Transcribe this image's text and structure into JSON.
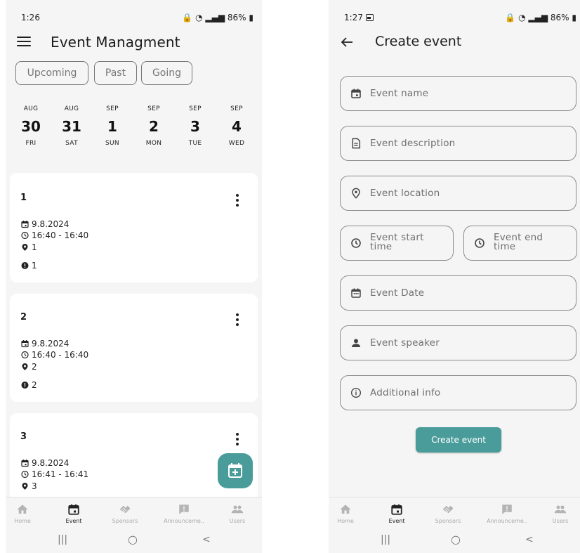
{
  "colors": {
    "accent": "#4a9c9b",
    "background": "#f5f5f5",
    "card": "#ffffff"
  },
  "left": {
    "status": {
      "time": "1:26",
      "battery": "86%"
    },
    "title": "Event Managment",
    "filters": [
      "Upcoming",
      "Past",
      "Going"
    ],
    "dates": [
      {
        "month": "AUG",
        "day": "30",
        "dow": "FRI"
      },
      {
        "month": "AUG",
        "day": "31",
        "dow": "SAT"
      },
      {
        "month": "SEP",
        "day": "1",
        "dow": "SUN"
      },
      {
        "month": "SEP",
        "day": "2",
        "dow": "MON"
      },
      {
        "month": "SEP",
        "day": "3",
        "dow": "TUE"
      },
      {
        "month": "SEP",
        "day": "4",
        "dow": "WED"
      }
    ],
    "events": [
      {
        "title": "1",
        "date": "9.8.2024",
        "time": "16:40 - 16:40",
        "location": "1",
        "info": "1"
      },
      {
        "title": "2",
        "date": "9.8.2024",
        "time": "16:40 - 16:40",
        "location": "2",
        "info": "2"
      },
      {
        "title": "3",
        "date": "9.8.2024",
        "time": "16:41 - 16:41",
        "location": "3"
      }
    ],
    "fab_icon": "calendar-add-icon"
  },
  "right": {
    "status": {
      "time": "1:27",
      "battery": "86%"
    },
    "title": "Create event",
    "fields": {
      "name": "Event name",
      "description": "Event description",
      "location": "Event location",
      "start_time": "Event start time",
      "end_time": "Event end time",
      "date": "Event Date",
      "speaker": "Event speaker",
      "info": "Additional info"
    },
    "create_button": "Create event"
  },
  "nav": [
    {
      "label": "Home",
      "icon": "home-icon"
    },
    {
      "label": "Event",
      "icon": "calendar-icon",
      "active": true
    },
    {
      "label": "Sponsors",
      "icon": "handshake-icon"
    },
    {
      "label": "Announceme..",
      "icon": "announcement-icon"
    },
    {
      "label": "Users",
      "icon": "users-icon"
    }
  ],
  "system_nav": {
    "recents": "|||",
    "home": "○",
    "back": "<"
  }
}
